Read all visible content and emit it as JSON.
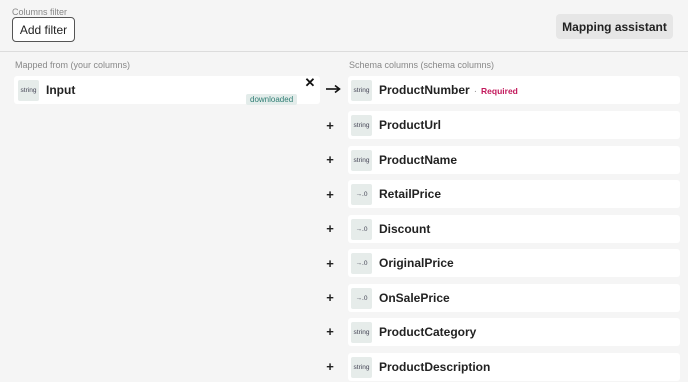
{
  "toolbar": {
    "filter_label": "Columns filter",
    "add_filter_label": "Add filter",
    "mapping_assistant_label": "Mapping assistant"
  },
  "left": {
    "section_label": "Mapped from (your columns)",
    "source": {
      "type": "string",
      "name": "Input",
      "tag": "downloaded"
    }
  },
  "right": {
    "section_label": "Schema columns (schema columns)",
    "separator": "·",
    "required_label": "Required",
    "rows": [
      {
        "type": "string",
        "name": "ProductNumber"
      },
      {
        "type": "string",
        "name": "ProductUrl"
      },
      {
        "type": "string",
        "name": "ProductName"
      },
      {
        "type": "→.0",
        "name": "RetailPrice"
      },
      {
        "type": "→.0",
        "name": "Discount"
      },
      {
        "type": "→.0",
        "name": "OriginalPrice"
      },
      {
        "type": "→.0",
        "name": "OnSalePrice"
      },
      {
        "type": "string",
        "name": "ProductCategory"
      },
      {
        "type": "string",
        "name": "ProductDescription"
      }
    ]
  },
  "icons": {
    "arrow": "arrow-right-icon",
    "plus": "plus-icon",
    "close": "close-icon",
    "plus_glyph": "+",
    "close_glyph": "✕"
  }
}
